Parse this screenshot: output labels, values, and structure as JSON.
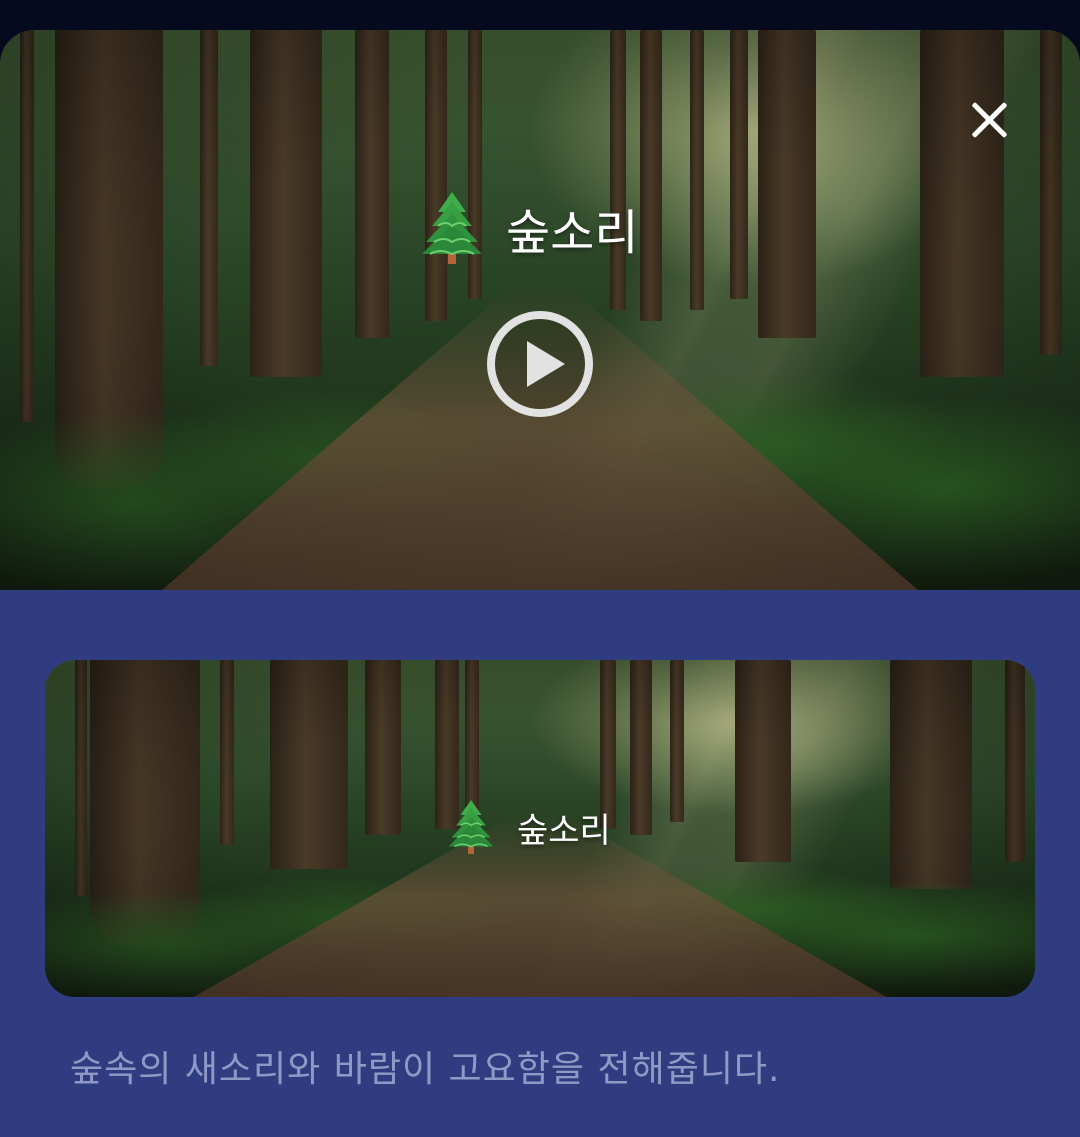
{
  "hero": {
    "icon": "evergreen-tree-icon",
    "title": "숲소리",
    "play_icon": "play-circle-icon",
    "close_icon": "close-icon"
  },
  "card": {
    "icon": "evergreen-tree-icon",
    "title": "숲소리"
  },
  "description": "숲속의 새소리와 바람이 고요함을 전해줍니다.",
  "colors": {
    "top_strip": "#060a1e",
    "panel_background": "#2f3d80",
    "description_text": "#8f99c5",
    "title_text": "#ffffff"
  }
}
